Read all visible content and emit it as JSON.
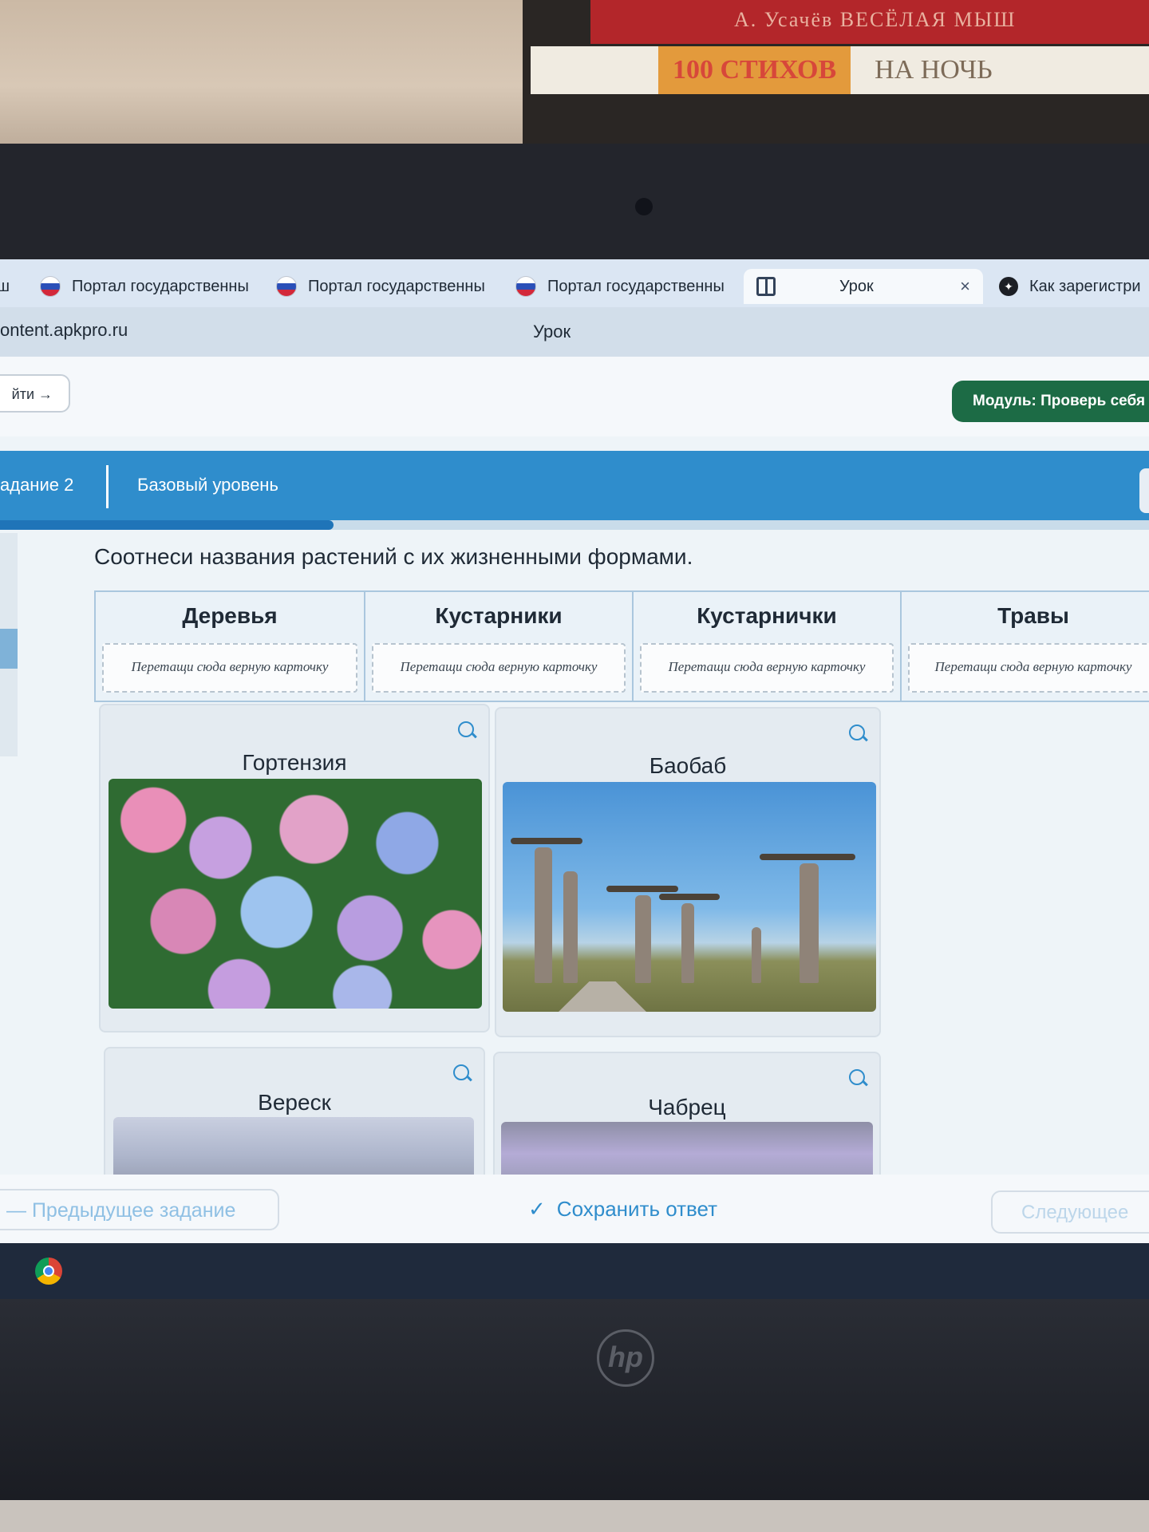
{
  "books": {
    "top_spine": "А. Усачёв   ВЕСЁЛАЯ МЫШ",
    "bottom_spine_number": "100 СТИХОВ",
    "bottom_spine_text": "НА НОЧЬ"
  },
  "laptop_brand": "hp",
  "browser": {
    "tabs": [
      {
        "label": "ш"
      },
      {
        "label": "Портал государственны"
      },
      {
        "label": "Портал государственны"
      },
      {
        "label": "Портал государственны"
      },
      {
        "label": "Урок",
        "active": true
      },
      {
        "label": "Как зарегистри"
      }
    ],
    "close_glyph": "×",
    "url": "ontent.apkpro.ru",
    "page_title": "Урок"
  },
  "header": {
    "back_label": "йти →",
    "module_label": "Модуль: Проверь себя"
  },
  "task": {
    "number_label": "адание 2",
    "level_label": "Базовый уровень",
    "progress": 0.29
  },
  "question": "Соотнеси названия растений с их жизненными формами.",
  "categories": [
    {
      "title": "Деревья",
      "drop_hint": "Перетащи сюда верную карточку"
    },
    {
      "title": "Кустарники",
      "drop_hint": "Перетащи сюда верную карточку"
    },
    {
      "title": "Кустарнички",
      "drop_hint": "Перетащи сюда верную карточку"
    },
    {
      "title": "Травы",
      "drop_hint": "Перетащи сюда верную карточку"
    }
  ],
  "cards": [
    {
      "title": "Гортензия",
      "image": "hydrangea-photo"
    },
    {
      "title": "Баобаб",
      "image": "baobab-photo"
    },
    {
      "title": "Вереск",
      "image": "heather-photo"
    },
    {
      "title": "Чабрец",
      "image": "thyme-photo"
    }
  ],
  "footer": {
    "prev_label": "— Предыдущее задание",
    "save_label": "Сохранить ответ",
    "save_icon": "check-icon",
    "next_label": "Следующее"
  },
  "colors": {
    "accent": "#2f8dcc",
    "module_button": "#1c6b45",
    "progress_fill": "#1f74b8"
  }
}
